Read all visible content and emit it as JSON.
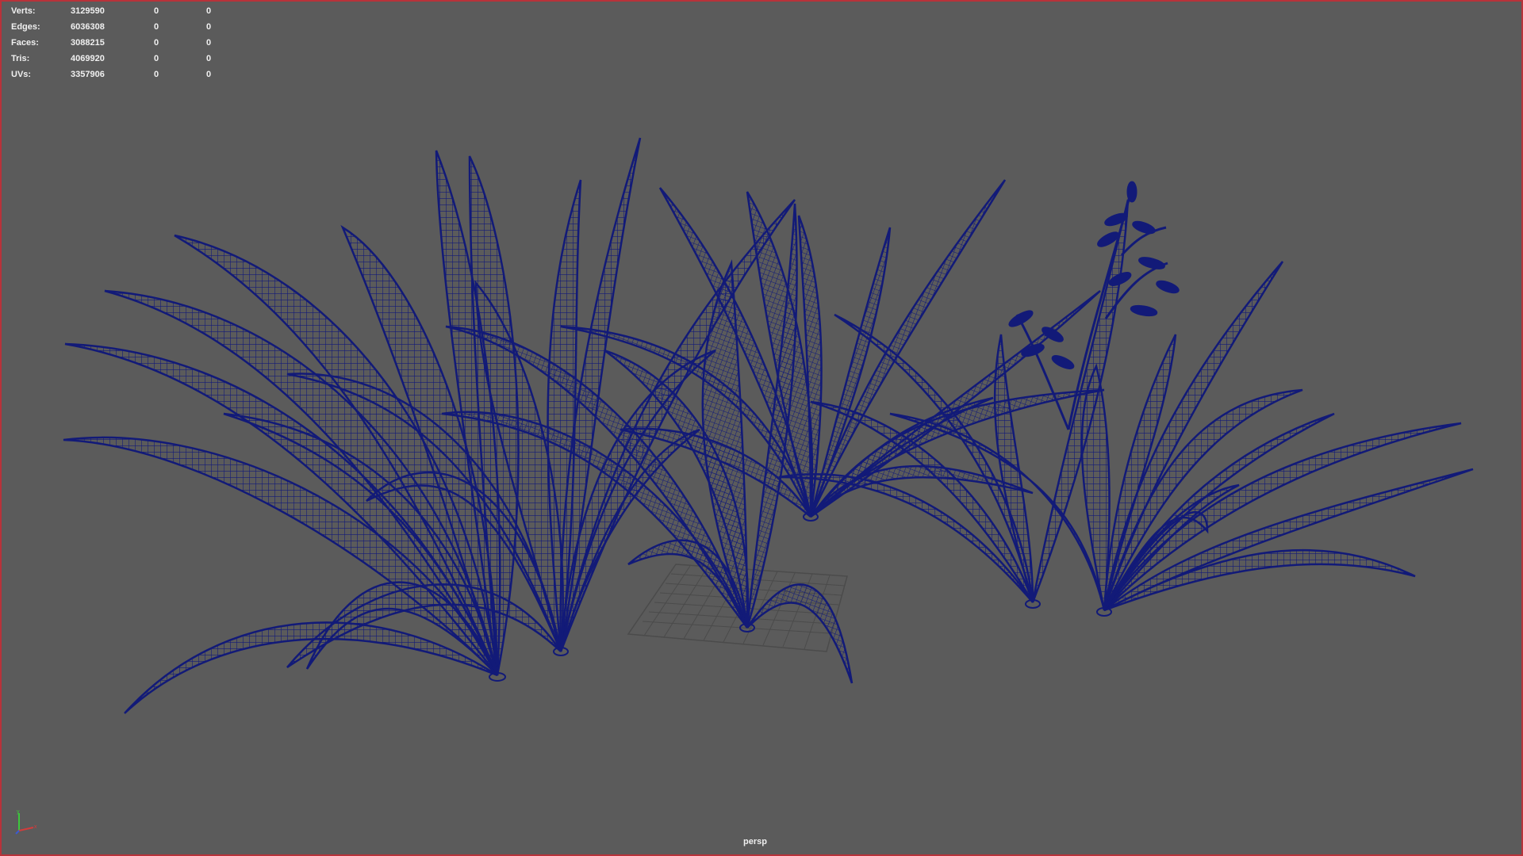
{
  "viewport": {
    "camera": "persp",
    "background_color": "#5b5b5b",
    "border_color": "#b8323a",
    "wireframe_color": "#121a78",
    "grid_color": "#4b4b4b"
  },
  "heads_up_display": {
    "rows": [
      {
        "label": "Verts:",
        "total": "3129590",
        "selected": "0",
        "component": "0"
      },
      {
        "label": "Edges:",
        "total": "6036308",
        "selected": "0",
        "component": "0"
      },
      {
        "label": "Faces:",
        "total": "3088215",
        "selected": "0",
        "component": "0"
      },
      {
        "label": "Tris:",
        "total": "4069920",
        "selected": "0",
        "component": "0"
      },
      {
        "label": "UVs:",
        "total": "3357906",
        "selected": "0",
        "component": "0"
      }
    ]
  },
  "view_axis": {
    "icon": "xyz-axis-gizmo-icon",
    "x_color": "#d23c3c",
    "y_color": "#3cc83c",
    "z_color": "#3c5ad2"
  }
}
